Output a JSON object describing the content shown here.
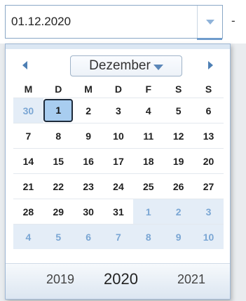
{
  "input": {
    "value": "01.12.2020"
  },
  "range_separator": "-",
  "calendar": {
    "month": "Dezember",
    "weekdays": [
      "M",
      "D",
      "M",
      "D",
      "F",
      "S",
      "S"
    ],
    "weeks": [
      [
        {
          "d": "30",
          "other": true
        },
        {
          "d": "1",
          "selected": true
        },
        {
          "d": "2"
        },
        {
          "d": "3"
        },
        {
          "d": "4"
        },
        {
          "d": "5"
        },
        {
          "d": "6"
        }
      ],
      [
        {
          "d": "7"
        },
        {
          "d": "8"
        },
        {
          "d": "9"
        },
        {
          "d": "10"
        },
        {
          "d": "11"
        },
        {
          "d": "12"
        },
        {
          "d": "13"
        }
      ],
      [
        {
          "d": "14"
        },
        {
          "d": "15"
        },
        {
          "d": "16"
        },
        {
          "d": "17"
        },
        {
          "d": "18"
        },
        {
          "d": "19"
        },
        {
          "d": "20"
        }
      ],
      [
        {
          "d": "21"
        },
        {
          "d": "22"
        },
        {
          "d": "23"
        },
        {
          "d": "24"
        },
        {
          "d": "25"
        },
        {
          "d": "26"
        },
        {
          "d": "27"
        }
      ],
      [
        {
          "d": "28"
        },
        {
          "d": "29"
        },
        {
          "d": "30"
        },
        {
          "d": "31"
        },
        {
          "d": "1",
          "other": true
        },
        {
          "d": "2",
          "other": true
        },
        {
          "d": "3",
          "other": true
        }
      ],
      [
        {
          "d": "4",
          "other": true
        },
        {
          "d": "5",
          "other": true
        },
        {
          "d": "6",
          "other": true
        },
        {
          "d": "7",
          "other": true
        },
        {
          "d": "8",
          "other": true
        },
        {
          "d": "9",
          "other": true
        },
        {
          "d": "10",
          "other": true
        }
      ]
    ],
    "years": {
      "prev": "2019",
      "current": "2020",
      "next": "2021"
    }
  },
  "icons": {
    "dropdown": "chevron-down-icon",
    "prev": "chevron-left-icon",
    "next": "chevron-right-icon"
  }
}
